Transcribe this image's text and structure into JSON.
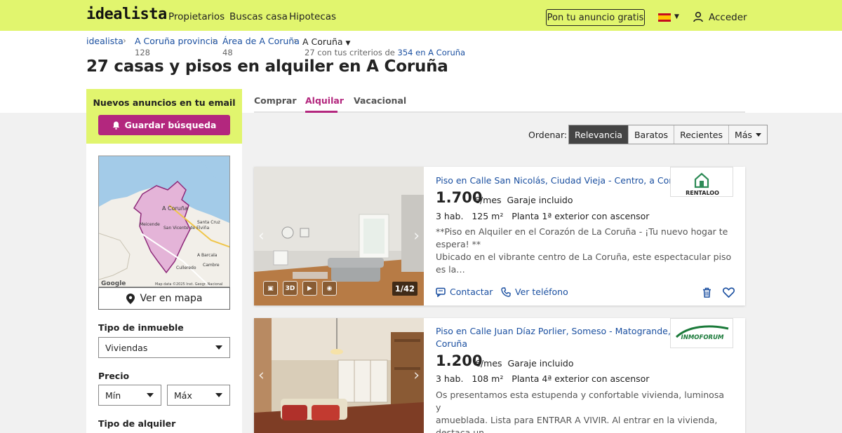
{
  "header": {
    "logo": "idealista",
    "nav": [
      "Propietarios",
      "Buscas casa",
      "Hipotecas"
    ],
    "cta": "Pon tu anuncio gratis",
    "login": "Acceder"
  },
  "breadcrumb": {
    "home": "idealista",
    "province": "A Coruña provincia",
    "province_count": "128",
    "area": "Área de A Coruña",
    "area_count": "48",
    "current": "A Coruña",
    "criteria_prefix": "27 con tus criterios de",
    "criteria_link": "354 en A Coruña"
  },
  "page_title": "27 casas y pisos en alquiler en A Coruña",
  "email_box": {
    "title": "Nuevos anuncios en tu email",
    "button": "Guardar búsqueda"
  },
  "map": {
    "btn": "Ver en mapa",
    "labels": [
      "A Coruña",
      "Meicende",
      "San Vicente de Elviña",
      "Santa Cruz",
      "A Barcala",
      "Culleredo",
      "Cambre"
    ],
    "google": "Google",
    "attribution": "Map data ©2025 Inst. Geogr. Nacional"
  },
  "filters": {
    "type_label": "Tipo de inmueble",
    "type_value": "Viviendas",
    "price_label": "Precio",
    "min": "Mín",
    "max": "Máx",
    "rent_type_label": "Tipo de alquiler"
  },
  "tabs": [
    "Comprar",
    "Alquilar",
    "Vacacional"
  ],
  "sort": {
    "label": "Ordenar:",
    "options": [
      "Relevancia",
      "Baratos",
      "Recientes",
      "Más"
    ]
  },
  "listings": [
    {
      "title": "Piso en Calle San Nicolás, Ciudad Vieja - Centro, a Coruña",
      "price": "1.700",
      "price_unit": "€/mes",
      "extra": "Garaje incluido",
      "details": "3 hab.   125 m²   Planta 1ª exterior con ascensor",
      "desc1": "**Piso en Alquiler en el Corazón de La Coruña - ¡Tu nuevo hogar te espera! **",
      "desc2": "Ubicado en el vibrante centro de La Coruña, este espectacular piso es la…",
      "counter": "1/42",
      "agency": "RENTALOO",
      "contact": "Contactar",
      "phone": "Ver teléfono"
    },
    {
      "title1": "Piso en Calle Juan Díaz Porlier, Someso - Matogrande, a",
      "title2": "Coruña",
      "price": "1.200",
      "price_unit": "€/mes",
      "extra": "Garaje incluido",
      "details": "3 hab.   108 m²   Planta 4ª exterior con ascensor",
      "desc1": "Os presentamos esta estupenda y confortable vivienda, luminosa y",
      "desc2": "amueblada. Lista para ENTRAR A VIVIR. Al entrar en la vivienda, destaca un…",
      "agency": "INMOFORUM"
    }
  ],
  "colors": {
    "brand_yellow": "#e1f56e",
    "accent_magenta": "#b3277e",
    "link_blue": "#1a4fa0"
  }
}
